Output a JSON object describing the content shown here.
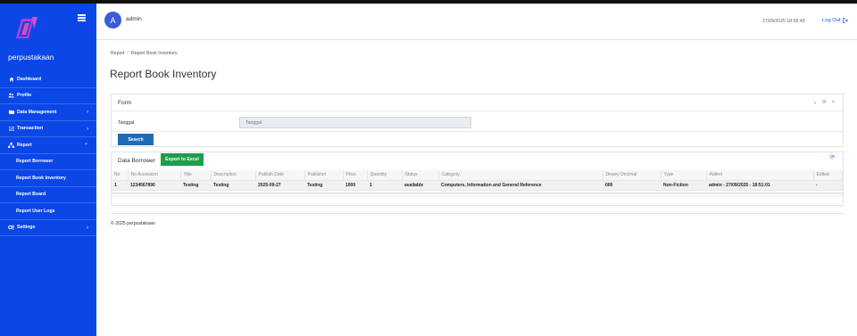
{
  "app": {
    "brand": "perpustakaan"
  },
  "sidebar": {
    "items": [
      {
        "label": "Dashboard",
        "icon": "home-icon"
      },
      {
        "label": "Profile",
        "icon": "users-icon"
      },
      {
        "label": "Data Management",
        "icon": "folder-icon",
        "chevron": "›"
      },
      {
        "label": "Transaction",
        "icon": "chart-icon",
        "chevron": "›"
      },
      {
        "label": "Report",
        "icon": "sitemap-icon",
        "chevron": "⌄"
      },
      {
        "label": "Report Borrower"
      },
      {
        "label": "Report Book Inventory"
      },
      {
        "label": "Report Board"
      },
      {
        "label": "Report User Logs"
      },
      {
        "label": "Settings",
        "icon": "gears-icon",
        "chevron": "›"
      }
    ]
  },
  "header": {
    "avatar_letter": "A",
    "username": "admin",
    "datetime": "27/09/2025 18:55:49",
    "logout": "Log Out"
  },
  "breadcrumb": {
    "root": "Report",
    "separator": "/",
    "current": "Report Book Inventory"
  },
  "page": {
    "title": "Report Book Inventory"
  },
  "form": {
    "title": "Form",
    "tools": [
      "⌄",
      "⟳",
      "×"
    ],
    "tanggal_label": "Tanggal",
    "tanggal_placeholder": "Tanggal",
    "search_label": "Search"
  },
  "borrower": {
    "title": "Data Borrower",
    "export_label": "Export to Excel",
    "refresh": "⟳",
    "columns": [
      "No",
      "No Accession",
      "Title",
      "Description",
      "Publish Date",
      "Publisher",
      "Price",
      "Quantity",
      "Status",
      "Category",
      "Dewey Decimal",
      "Type",
      "Added",
      "Edited"
    ],
    "rows": [
      [
        "1",
        "1234567890",
        "Testing",
        "Testing",
        "2025-09-27",
        "Testing",
        "1000",
        "1",
        "available",
        "Computers, Information and General Reference",
        "000",
        "Non-Fiction",
        "admin - 27/09/2025 - 18:51:01",
        "-"
      ]
    ]
  },
  "footer": {
    "text": "© 2025 perpustakaan"
  },
  "colors": {
    "sidebar": "#0a47e6",
    "search": "#1d6cb8",
    "export": "#1e9e4a",
    "avatar": "#3b5bdb"
  }
}
